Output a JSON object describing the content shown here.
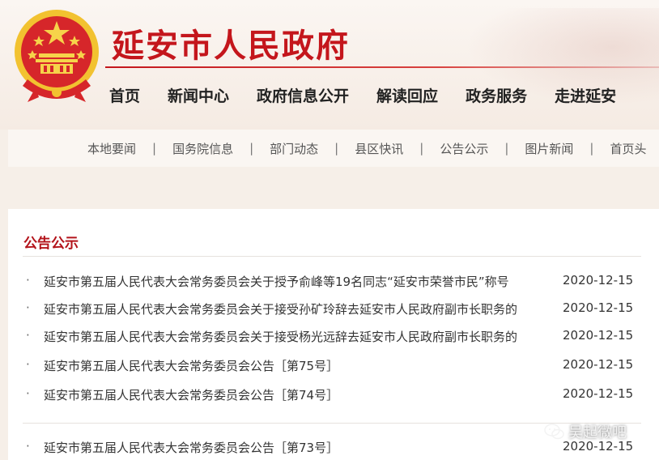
{
  "site": {
    "title": "延安市人民政府"
  },
  "main_nav": [
    "首页",
    "新闻中心",
    "政府信息公开",
    "解读回应",
    "政务服务",
    "走进延安"
  ],
  "sub_nav": [
    "本地要闻",
    "国务院信息",
    "部门动态",
    "县区快讯",
    "公告公示",
    "图片新闻",
    "首页头"
  ],
  "sub_nav_separator": "|",
  "section": {
    "title": "公告公示",
    "bullet": "·",
    "items": [
      {
        "title": "延安市第五届人民代表大会常务委员会关于授予俞峰等19名同志“延安市荣誉市民”称号",
        "date": "2020-12-15"
      },
      {
        "title": "延安市第五届人民代表大会常务委员会关于接受孙矿玲辞去延安市人民政府副市长职务的",
        "date": "2020-12-15"
      },
      {
        "title": "延安市第五届人民代表大会常务委员会关于接受杨光远辞去延安市人民政府副市长职务的",
        "date": "2020-12-15"
      },
      {
        "title": "延安市第五届人民代表大会常务委员会公告［第75号］",
        "date": "2020-12-15"
      },
      {
        "title": "延安市第五届人民代表大会常务委员会公告［第74号］",
        "date": "2020-12-15"
      },
      {
        "title": "延安市第五届人民代表大会常务委员会公告［第73号］",
        "date": "2020-12-15"
      }
    ]
  },
  "watermark": {
    "text": "吴起微吧"
  },
  "colors": {
    "brand_red": "#c4161c",
    "gold": "#f2c230"
  }
}
